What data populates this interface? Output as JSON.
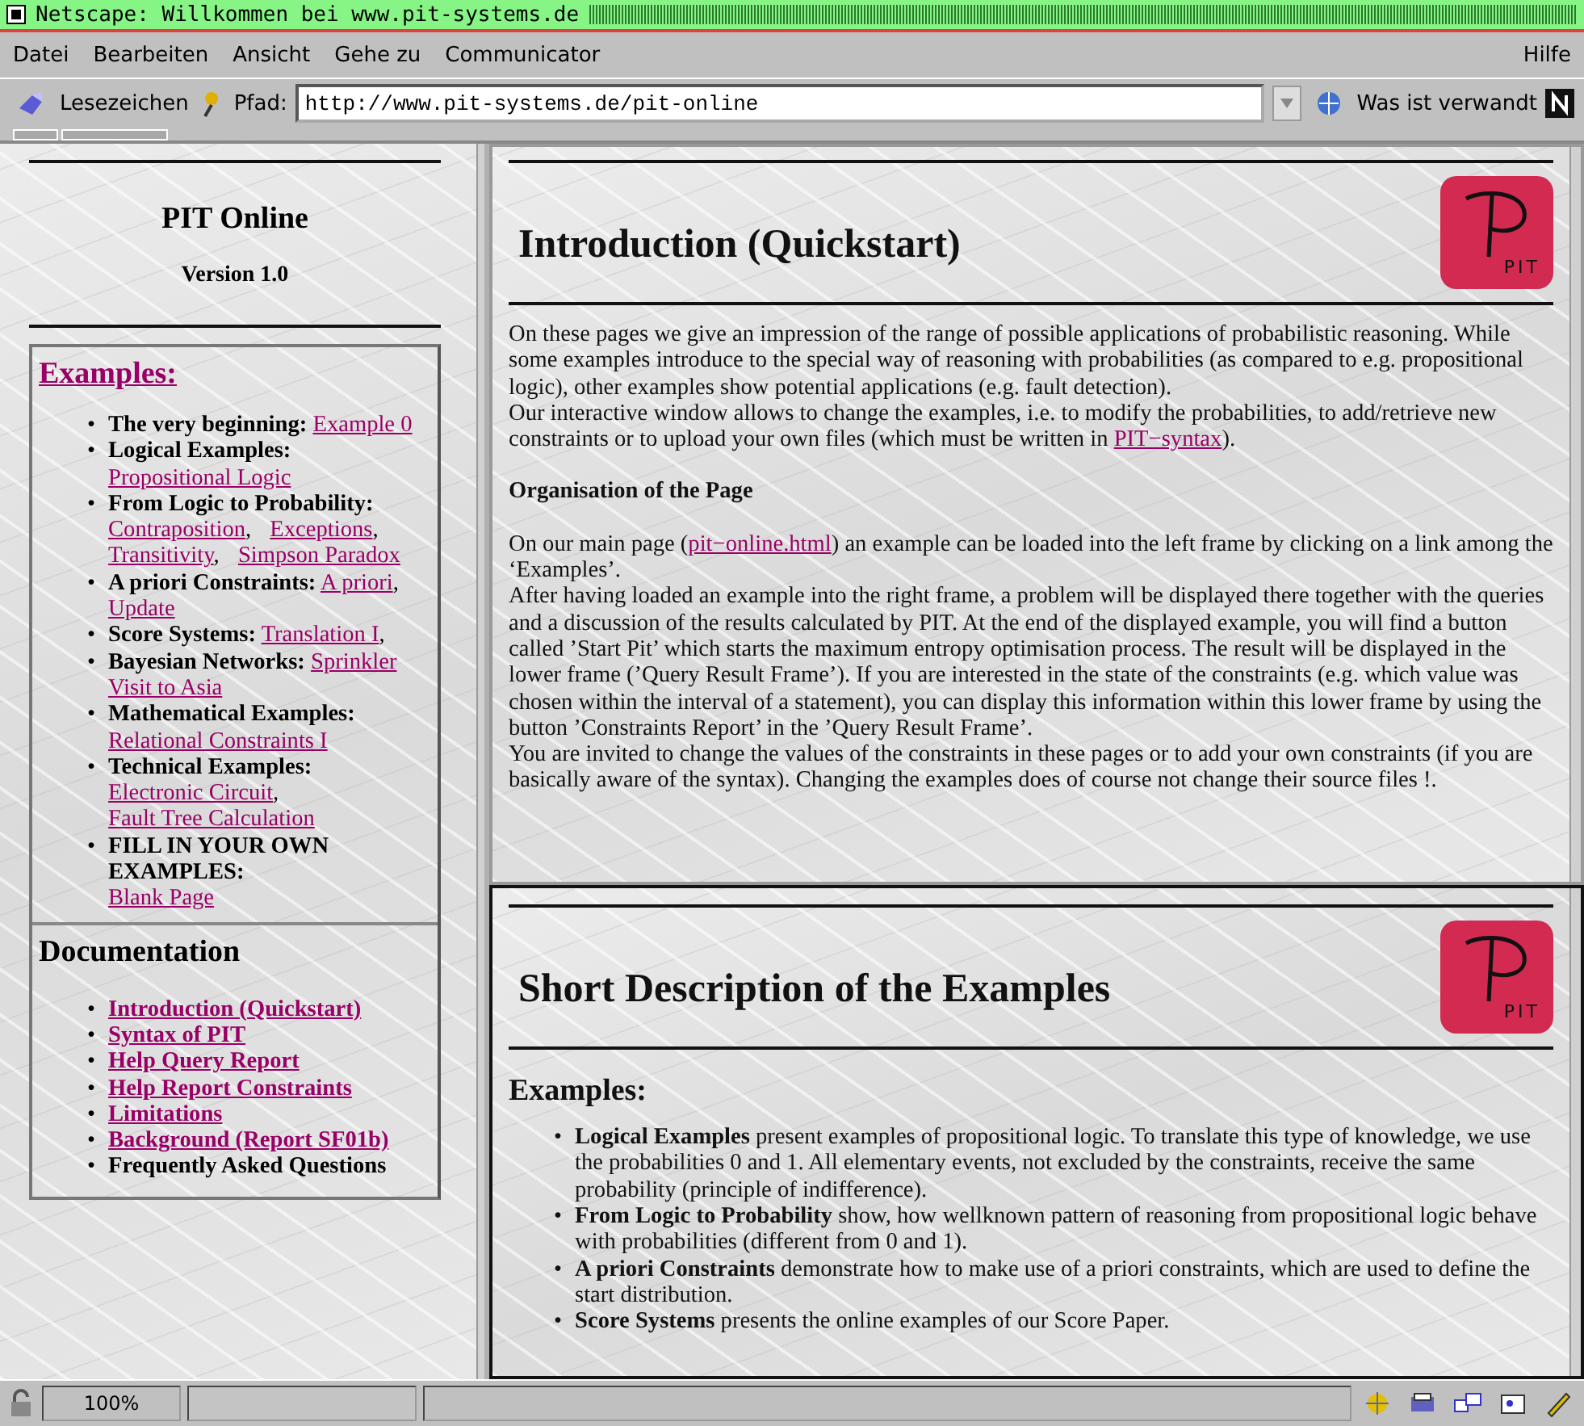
{
  "window": {
    "title": "Netscape: Willkommen bei www.pit-systems.de"
  },
  "menu": [
    "Datei",
    "Bearbeiten",
    "Ansicht",
    "Gehe zu",
    "Communicator"
  ],
  "help_menu": "Hilfe",
  "toolbar": {
    "bookmarks": "Lesezeichen",
    "location_label": "Pfad:",
    "url": "http://www.pit-systems.de/pit-online",
    "related": "Was ist verwandt"
  },
  "sidebar": {
    "title": "PIT Online",
    "version": "Version 1.0",
    "examples_heading": "Examples:",
    "examples": [
      {
        "label": "The very beginning:",
        "links": [
          {
            "text": "Example 0"
          }
        ]
      },
      {
        "label": "Logical Examples:",
        "links": [
          {
            "text": "Propositional Logic"
          }
        ]
      },
      {
        "label": "From Logic to Probability:",
        "links": [
          {
            "text": "Contraposition",
            "after": ","
          },
          {
            "text": "Exceptions",
            "after": ","
          },
          {
            "text": "Transitivity",
            "after": ","
          },
          {
            "text": "Simpson Paradox"
          }
        ]
      },
      {
        "label": "A priori Constraints:",
        "links": [
          {
            "text": "A priori",
            "after": ","
          },
          {
            "text": "Update"
          }
        ]
      },
      {
        "label": "Score Systems:",
        "links": [
          {
            "text": "Translation I",
            "after": ","
          }
        ]
      },
      {
        "label": "Bayesian Networks:",
        "links": [
          {
            "text": "Sprinkler"
          },
          {
            "text": "Visit to Asia"
          }
        ]
      },
      {
        "label": "Mathematical Examples:",
        "links": [
          {
            "text": "Relational Constraints I"
          }
        ]
      },
      {
        "label": "Technical Examples:",
        "links": [
          {
            "text": "Electronic Circuit",
            "after": ","
          },
          {
            "text": "Fault Tree Calculation"
          }
        ]
      },
      {
        "label": "FILL IN YOUR OWN EXAMPLES:",
        "links": [
          {
            "text": "Blank Page"
          }
        ]
      }
    ],
    "documentation_heading": "Documentation",
    "documentation": [
      {
        "text": "Introduction (Quickstart)",
        "kind": "link"
      },
      {
        "text": "Syntax of PIT",
        "kind": "link"
      },
      {
        "text": "Help Query Report",
        "kind": "link"
      },
      {
        "text": "Help Report Constraints",
        "kind": "link"
      },
      {
        "text": "Limitations",
        "kind": "link"
      },
      {
        "text": "Background (Report SF01b)",
        "kind": "link"
      },
      {
        "text": "Frequently Asked Questions",
        "kind": "plain"
      }
    ]
  },
  "intro": {
    "heading": "Introduction (Quickstart)",
    "logo": "PIT",
    "blocks": [
      {
        "kind": "text",
        "lines": [
          [
            {
              "kind": "text",
              "text": "On these pages we give an impression of the range of possible applications of probabilistic reasoning. While some examples introduce to the special way of reasoning with probabilities (as compared to e.g. propositional logic), other examples show potential applications (e.g. fault detection)."
            }
          ],
          [
            {
              "kind": "text",
              "text": "Our interactive window allows to change the examples, i.e. to modify the probabilities, to add/retrieve new constraints or to upload your own files (which must be written in "
            },
            {
              "kind": "link",
              "text": "PIT−syntax"
            },
            {
              "kind": "text",
              "text": ")."
            }
          ]
        ]
      },
      {
        "kind": "heading",
        "text": "Organisation of the Page"
      },
      {
        "kind": "text",
        "lines": [
          [
            {
              "kind": "text",
              "text": "On our main page ("
            },
            {
              "kind": "link",
              "text": "pit−online.html"
            },
            {
              "kind": "text",
              "text": ") an example can be loaded into the left frame by clicking on a link among the ‘Examples’."
            }
          ],
          [
            {
              "kind": "text",
              "text": "After having loaded an example into the right frame, a problem will be displayed there together with the queries and a discussion of the results calculated by PIT. At the end of the displayed example, you will find a button called ’Start Pit’ which starts the maximum entropy optimisation process. The result will be displayed in the lower frame (’Query Result Frame’). If you are interested in the state of the constraints (e.g. which value was chosen within the interval of a statement), you can display this information within this lower frame by using the button ’Constraints Report’ in the ’Query Result Frame’."
            }
          ],
          [
            {
              "kind": "text",
              "text": "You are invited to change the values of the constraints in these pages or to add your own constraints (if you are basically aware of the syntax). Changing the examples does of course not change their source files !."
            }
          ]
        ]
      }
    ]
  },
  "description": {
    "heading": "Short Description of the Examples",
    "logo": "PIT",
    "subheading": "Examples:",
    "items": [
      "**Logical Examples** present examples of propositional logic. To translate this type of knowledge, we use the probabilities 0 and 1. All elementary events, not excluded by the constraints, receive the same probability (principle of indifference).",
      "**From Logic to Probability** show, how wellknown pattern of reasoning from propositional logic behave with probabilities (different from 0 and 1).",
      "**A priori Constraints** demonstrate how to make use of a priori constraints, which are used to define the start distribution.",
      "**Score Systems** presents the online examples of our Score Paper."
    ]
  },
  "bullet": "•",
  "status_bar": {
    "zoom": "100%"
  }
}
